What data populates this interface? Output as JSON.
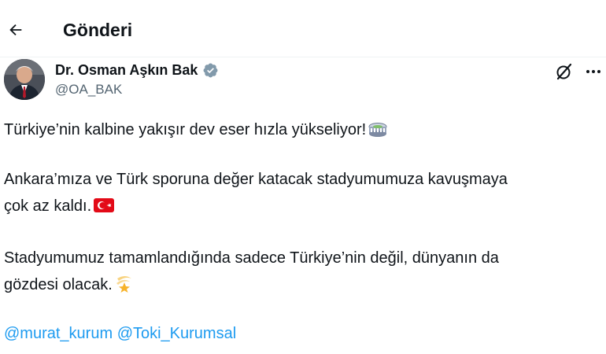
{
  "header": {
    "title": "Gönderi"
  },
  "author": {
    "name": "Dr. Osman Aşkın Bak",
    "handle": "@OA_BAK"
  },
  "post": {
    "line1": "Türkiye’nin kalbine yakışır dev eser hızla yükseliyor!",
    "line2": "Ankara’mıza ve Türk sporuna değer katacak stadyumumuza kavuşmaya",
    "line3": "çok az kaldı.",
    "line4": "Stadyumumuz tamamlandığında sadece Türkiye’nin değil, dünyanın da",
    "line5": "gözdesi olacak.",
    "mentions": [
      "@murat_kurum",
      "@Toki_Kurumsal"
    ]
  },
  "icons": {
    "back": "arrow-left-icon",
    "verified": "verified-badge-icon",
    "grok": "grok-icon",
    "more": "more-horizontal-icon",
    "emoji_stadium": "stadium-emoji",
    "emoji_flag": "turkey-flag-emoji",
    "emoji_dizzy": "dizzy-star-emoji"
  },
  "colors": {
    "text": "#0f1419",
    "secondary": "#536471",
    "link": "#1d9bf0",
    "verified": "#829aab",
    "flag_red": "#e30a17"
  }
}
